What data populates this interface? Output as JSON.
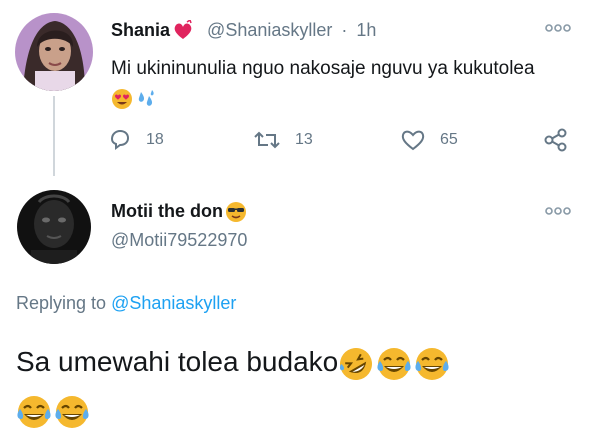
{
  "original_tweet": {
    "display_name": "Shania",
    "handle": "@Shaniaskyller",
    "separator": "·",
    "time": "1h",
    "text": "Mi ukininunulia nguo nakosaje nguvu ya kukutolea",
    "name_emoji": "heart-ribbon-icon",
    "text_emojis": [
      "heart-eyes-emoji",
      "sweat-droplets-emoji"
    ],
    "counts": {
      "replies": "18",
      "retweets": "13",
      "likes": "65"
    }
  },
  "reply_tweet": {
    "display_name": "Motii the don",
    "name_emoji": "sunglasses-emoji",
    "handle": "@Motii79522970",
    "replying_prefix": "Replying to",
    "replying_to": "@Shaniaskyller",
    "text": "Sa umewahi tolea budako",
    "text_emojis": [
      "rofl-emoji",
      "joy-emoji",
      "joy-emoji",
      "joy-emoji",
      "joy-emoji"
    ]
  },
  "ui": {
    "more_icon": "more-options-icon",
    "colors": {
      "text": "#14171a",
      "secondary": "#657786",
      "link": "#1da1f2",
      "emoji_yellow": "#f5b82e"
    }
  }
}
